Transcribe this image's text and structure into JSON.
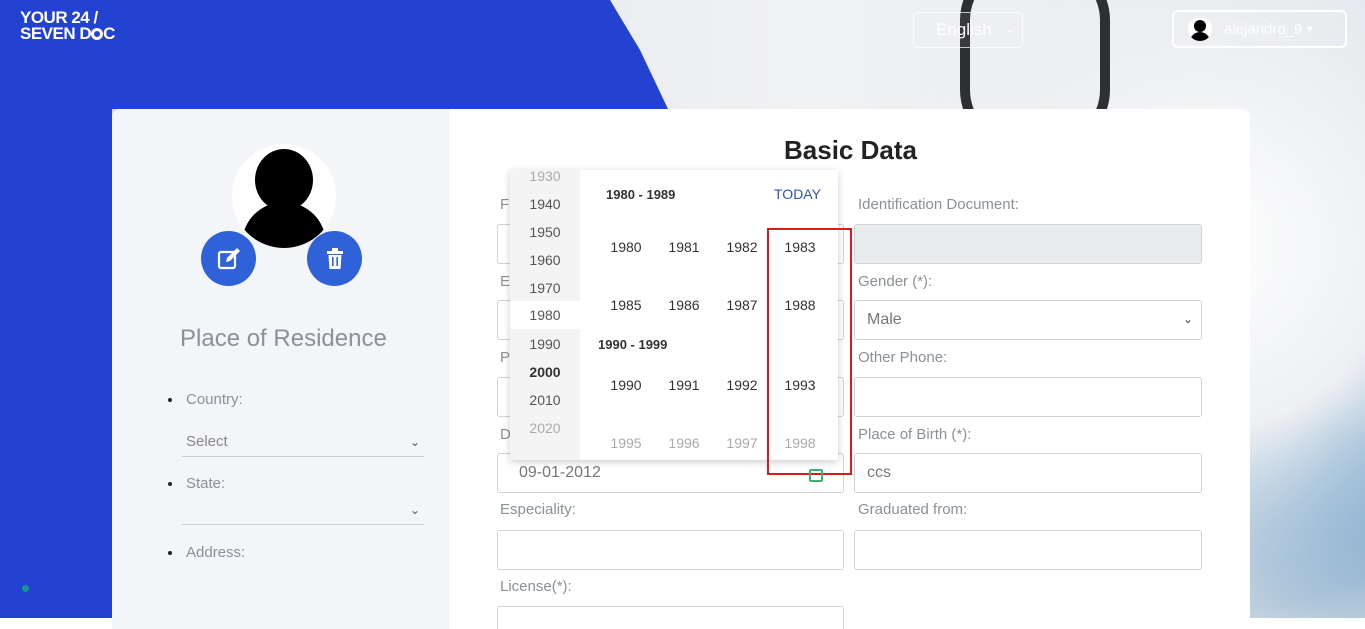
{
  "header": {
    "logo_line1": "YOUR 24 /",
    "logo_line2": "SEVEN D",
    "logo_line2b": "C",
    "language": "English",
    "username": "alejandro_9"
  },
  "left_panel": {
    "place_title": "Place of Residence",
    "country_label": "Country:",
    "country_value": "Select",
    "state_label": "State:",
    "state_value": "",
    "address_label": "Address:"
  },
  "form": {
    "title": "Basic Data",
    "identification_label": "Identification Document:",
    "identification_value": "",
    "gender_label": "Gender (*):",
    "gender_value": "Male",
    "other_phone_label": "Other Phone:",
    "place_of_birth_label": "Place of Birth (*):",
    "place_of_birth_value": "ccs",
    "date_value": "09-01-2012",
    "especiality_label": "Especiality:",
    "graduated_label": "Graduated from:",
    "license_label": "License(*):",
    "left_label_f": "F",
    "left_label_e": "E",
    "left_label_p": "P",
    "left_label_d": "D"
  },
  "picker": {
    "decades": [
      "1930",
      "1940",
      "1950",
      "1960",
      "1970",
      "1980",
      "1990",
      "2000",
      "2010",
      "2020"
    ],
    "group1_title": "1980 - 1989",
    "group2_title": "1990 - 1999",
    "today_label": "TODAY",
    "group1_years": [
      "1980",
      "1981",
      "1982",
      "1983",
      "1985",
      "1986",
      "1987",
      "1988"
    ],
    "group2_years": [
      "1990",
      "1991",
      "1992",
      "1993",
      "1995",
      "1996",
      "1997",
      "1998"
    ]
  },
  "colors": {
    "brand_blue": "#2342d2",
    "button_blue": "#2f62d9",
    "link_blue": "#2c55b8",
    "highlight_red": "#e0181b"
  }
}
